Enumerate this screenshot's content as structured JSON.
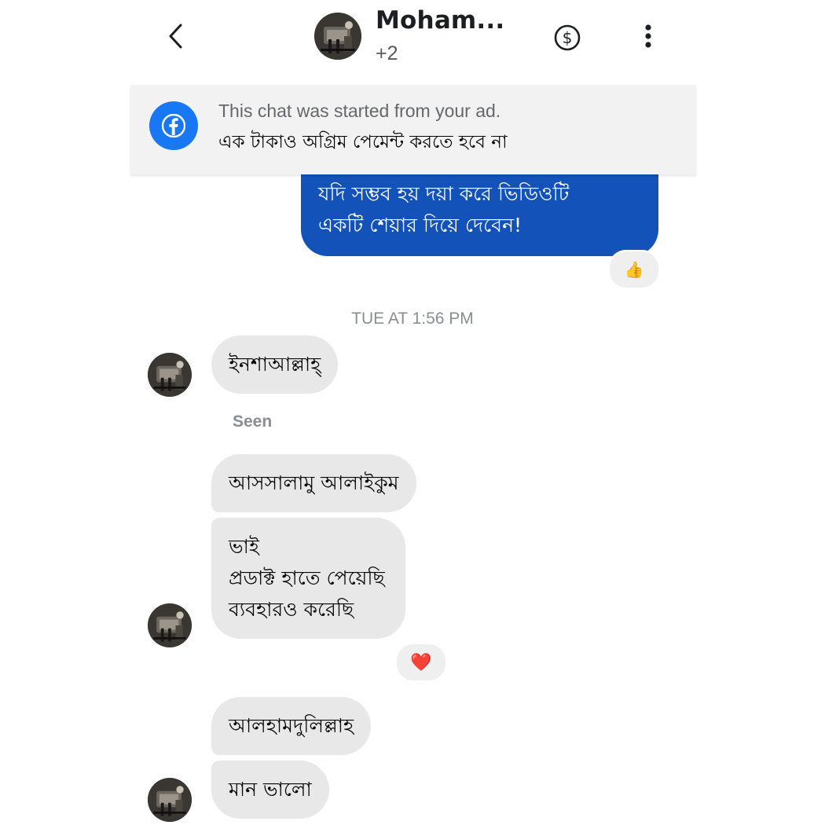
{
  "header": {
    "title": "Moham...",
    "participants_extra": "+2",
    "back_icon": "chevron-left-icon",
    "payment_icon": "dollar-circle-icon",
    "more_icon": "vertical-ellipsis-icon"
  },
  "ad_banner": {
    "icon": "facebook-icon",
    "notice": "This chat was started from your ad.",
    "text": "এক টাকাও অগ্রিম পেমেন্ট করতে হবে না"
  },
  "messages": {
    "outgoing_1": {
      "text": "যদি সম্ভব হয় দয়া করে ভিডিওটি\nএকটি শেয়ার দিয়ে দেবেন!",
      "reaction": "👍"
    },
    "timestamp": "TUE AT 1:56 PM",
    "incoming_1": "ইনশাআল্লাহ্",
    "seen_label": "Seen",
    "incoming_2": "আসসালামু আলাইকুম",
    "incoming_3": {
      "text": "ভাই\nপ্রডাক্ট হাতে পেয়েছি\nব্যবহারও করেছি",
      "reaction": "❤️"
    },
    "incoming_4": "আলহামদুলিল্লাহ",
    "incoming_5": "মান ভালো"
  },
  "colors": {
    "outgoing_bubble": "#1352b8",
    "incoming_bubble": "#e8e8e8",
    "facebook_blue": "#1877f2",
    "timestamp_gray": "#8a8d91"
  }
}
